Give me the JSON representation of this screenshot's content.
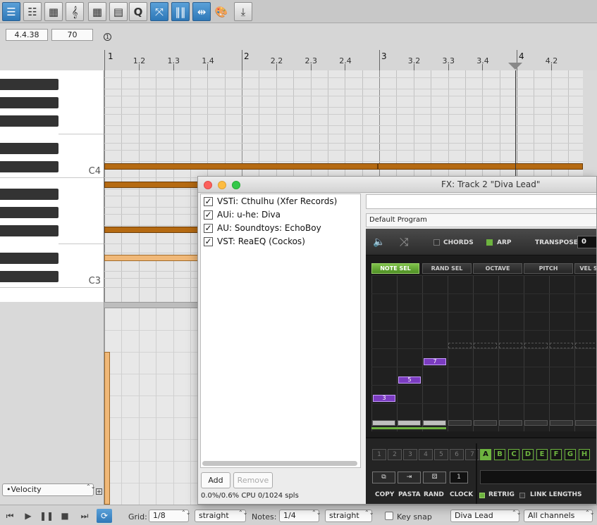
{
  "window": {
    "position": "4.4.38",
    "value": "70",
    "marker": "1"
  },
  "ruler": {
    "labels": [
      {
        "t": "1",
        "bar": true
      },
      {
        "t": "1.2"
      },
      {
        "t": "1.3"
      },
      {
        "t": "1.4"
      },
      {
        "t": "2",
        "bar": true
      },
      {
        "t": "2.2"
      },
      {
        "t": "2.3"
      },
      {
        "t": "2.4"
      },
      {
        "t": "3",
        "bar": true
      },
      {
        "t": "3.2"
      },
      {
        "t": "3.3"
      },
      {
        "t": "3.4"
      },
      {
        "t": "4",
        "bar": true
      },
      {
        "t": "4.2"
      }
    ]
  },
  "keyboard": {
    "c4_label": "C4",
    "c3_label": "C3"
  },
  "fx": {
    "title": "FX: Track 2 \"Diva Lead\"",
    "plugins": [
      {
        "name": "VSTi: Cthulhu (Xfer Records)",
        "checked": "✓"
      },
      {
        "name": "AUi: u-he: Diva",
        "checked": "✓"
      },
      {
        "name": "AU: Soundtoys: EchoBoy",
        "checked": "✓"
      },
      {
        "name": "VST: ReaEQ (Cockos)",
        "checked": "✓"
      }
    ],
    "add_label": "Add",
    "remove_label": "Remove",
    "cpu": "0.0%/0.6% CPU 0/1024 spls",
    "preset": "Default Program"
  },
  "plugin": {
    "chords_label": "CHORDS",
    "arp_label": "ARP",
    "transpose_label": "TRANSPOSE",
    "transpose_value": "0",
    "headers": [
      "NOTE SEL",
      "RAND SEL",
      "OCTAVE",
      "PITCH",
      "VEL S"
    ],
    "notes": [
      "3",
      "5",
      "7"
    ],
    "steps": [
      "1",
      "2",
      "3",
      "4",
      "5",
      "6",
      "7"
    ],
    "keys": [
      "A",
      "B",
      "C",
      "D",
      "E",
      "F",
      "G",
      "H"
    ],
    "clock_value": "1",
    "labels": {
      "copy": "COPY",
      "pasta": "PASTA",
      "rand": "RAND",
      "clock": "CLOCK",
      "retrig": "RETRIG",
      "link": "LINK LENGTHS"
    }
  },
  "velocity": {
    "lane": "•Velocity"
  },
  "bottom": {
    "grid_label": "Grid:",
    "grid_value": "1/8",
    "grid_mode": "straight",
    "notes_label": "Notes:",
    "notes_value": "1/4",
    "notes_mode": "straight",
    "key_snap": "Key snap",
    "track": "Diva Lead",
    "channels": "All channels"
  },
  "colors": {
    "note": "#b56a12",
    "accent": "#2e78b8",
    "arp_green": "#6db33f",
    "arp_purple": "#7b3cc0"
  }
}
